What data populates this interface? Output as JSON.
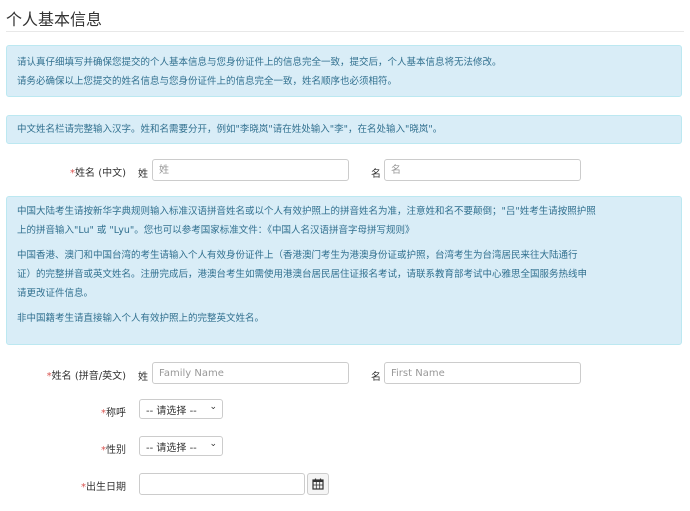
{
  "page": {
    "title": "个人基本信息"
  },
  "notices": {
    "top": {
      "line1": "请认真仔细填写并确保您提交的个人基本信息与您身份证件上的信息完全一致，提交后，个人基本信息将无法修改。",
      "line2": "请务必确保以上您提交的姓名信息与您身份证件上的信息完全一致，姓名顺序也必须相符。"
    },
    "chinese_name_hint": "中文姓名栏请完整输入汉字。姓和名需要分开，例如\"李晓岚\"请在姓处输入\"李\"，在名处输入\"晓岚\"。",
    "pinyin": {
      "para1_a": "中国大陆考生请按新华字典规则输入标准汉语拼音姓名或以个人有效护照上的拼音姓名为准，注意姓和名不要颠倒；\"吕\"姓考生请按照护照",
      "para1_b": "上的拼音输入\"Lu\" 或 \"Lyu\"。您也可以参考国家标准文件：",
      "para1_link": "《中国人名汉语拼音字母拼写规则》",
      "para2_a": "中国香港、澳门和中国台湾的考生请输入个人有效身份证件上（香港澳门考生为港澳身份证或护照，台湾考生为台湾居民来往大陆通行",
      "para2_b": "证）的完整拼音或英文姓名。注册完成后，港澳台考生如需使用港澳台居民居住证报名考试，请联系教育部考试中心雅思全国服务热线申",
      "para2_c": "请更改证件信息。",
      "para3": "非中国籍考生请直接输入个人有效护照上的完整英文姓名。"
    }
  },
  "form": {
    "required_mark": "*",
    "name_cn": {
      "label": "姓名 (中文)",
      "surname_prefix": "姓",
      "surname_placeholder": "姓",
      "given_prefix": "名",
      "given_placeholder": "名"
    },
    "name_en": {
      "label": "姓名 (拼音/英文)",
      "surname_prefix": "姓",
      "surname_placeholder": "Family Name",
      "given_prefix": "名",
      "given_placeholder": "First Name"
    },
    "salutation": {
      "label": "称呼",
      "selected": "-- 请选择 --"
    },
    "gender": {
      "label": "性别",
      "selected": "-- 请选择 --"
    },
    "birthdate": {
      "label": "出生日期",
      "value": ""
    }
  }
}
